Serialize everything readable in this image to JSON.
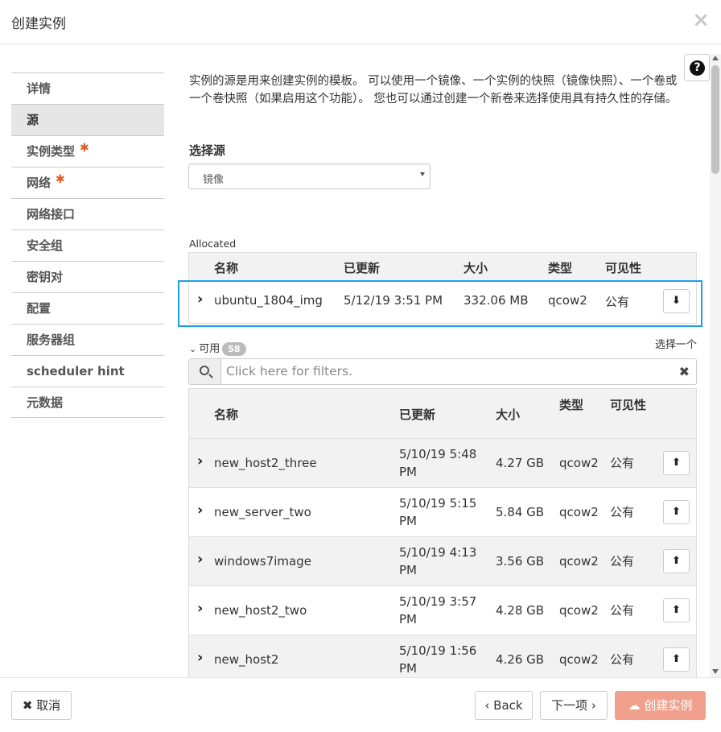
{
  "dialog": {
    "title": "创建实例",
    "close_icon": "×"
  },
  "sidebar": {
    "items": [
      {
        "label": "详情",
        "required": false
      },
      {
        "label": "源",
        "required": false,
        "active": true
      },
      {
        "label": "实例类型",
        "required": true
      },
      {
        "label": "网络",
        "required": true
      },
      {
        "label": "网络接口",
        "required": false
      },
      {
        "label": "安全组",
        "required": false
      },
      {
        "label": "密钥对",
        "required": false
      },
      {
        "label": "配置",
        "required": false
      },
      {
        "label": "服务器组",
        "required": false
      },
      {
        "label": "scheduler hint",
        "required": false
      },
      {
        "label": "元数据",
        "required": false
      }
    ],
    "required_mark": "✱"
  },
  "help_icon": "?",
  "description": "实例的源是用来创建实例的模板。 可以使用一个镜像、一个实例的快照（镜像快照）、一个卷或一个卷快照（如果启用这个功能）。 您也可以通过创建一个新卷来选择使用具有持久性的存储。",
  "source": {
    "label": "选择源",
    "selected": "镜像"
  },
  "allocated": {
    "label": "Allocated",
    "headers": {
      "name": "名称",
      "updated": "已更新",
      "size": "大小",
      "type": "类型",
      "visibility": "可见性"
    },
    "rows": [
      {
        "name": "ubuntu_1804_img",
        "updated": "5/12/19 3:51 PM",
        "size": "332.06 MB",
        "type": "qcow2",
        "visibility": "公有"
      }
    ]
  },
  "available": {
    "label": "可用",
    "count": "58",
    "pick_one": "选择一个",
    "filter_placeholder": "Click here for filters.",
    "clear_icon": "✖",
    "headers": {
      "name": "名称",
      "updated": "已更新",
      "size": "大小",
      "type": "类型",
      "visibility": "可见性"
    },
    "rows": [
      {
        "name": "new_host2_three",
        "updated_1": "5/10/19 5:48",
        "updated_2": "PM",
        "size": "4.27 GB",
        "type": "qcow2",
        "visibility": "公有"
      },
      {
        "name": "new_server_two",
        "updated_1": "5/10/19 5:15",
        "updated_2": "PM",
        "size": "5.84 GB",
        "type": "qcow2",
        "visibility": "公有"
      },
      {
        "name": "windows7image",
        "updated_1": "5/10/19 4:13",
        "updated_2": "PM",
        "size": "3.56 GB",
        "type": "qcow2",
        "visibility": "公有"
      },
      {
        "name": "new_host2_two",
        "updated_1": "5/10/19 3:57",
        "updated_2": "PM",
        "size": "4.28 GB",
        "type": "qcow2",
        "visibility": "公有"
      },
      {
        "name": "new_host2",
        "updated_1": "5/10/19 1:56",
        "updated_2": "PM",
        "size": "4.26 GB",
        "type": "qcow2",
        "visibility": "公有"
      }
    ]
  },
  "footer": {
    "cancel": "取消",
    "back": "Back",
    "next": "下一项",
    "create": "创建实例"
  }
}
